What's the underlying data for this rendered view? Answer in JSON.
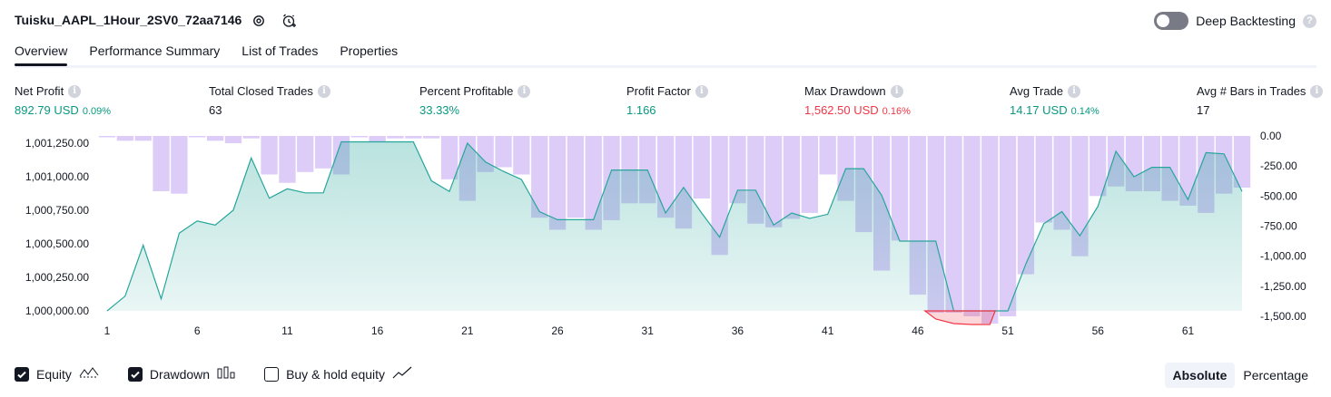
{
  "header": {
    "title": "Tuisku_AAPL_1Hour_2SV0_72aa7146",
    "settings_icon": "gear-icon",
    "alert_icon": "alarm-clock-plus-icon",
    "deep_backtesting_label": "Deep Backtesting",
    "deep_backtesting_enabled": false,
    "help_mark": "?"
  },
  "tabs": [
    {
      "label": "Overview",
      "active": true
    },
    {
      "label": "Performance Summary",
      "active": false
    },
    {
      "label": "List of Trades",
      "active": false
    },
    {
      "label": "Properties",
      "active": false
    }
  ],
  "stats": [
    {
      "label": "Net Profit",
      "value": "892.79 USD",
      "pct": "0.09%",
      "tone": "pos"
    },
    {
      "label": "Total Closed Trades",
      "value": "63",
      "pct": "",
      "tone": "neu"
    },
    {
      "label": "Percent Profitable",
      "value": "33.33%",
      "pct": "",
      "tone": "pos"
    },
    {
      "label": "Profit Factor",
      "value": "1.166",
      "pct": "",
      "tone": "pos"
    },
    {
      "label": "Max Drawdown",
      "value": "1,562.50 USD",
      "pct": "0.16%",
      "tone": "neg"
    },
    {
      "label": "Avg Trade",
      "value": "14.17 USD",
      "pct": "0.14%",
      "tone": "pos"
    },
    {
      "label": "Avg # Bars in Trades",
      "value": "17",
      "pct": "",
      "tone": "neu"
    }
  ],
  "info_mark": "i",
  "chart_data": {
    "type": "line",
    "x_ticks": [
      "1",
      "6",
      "11",
      "16",
      "21",
      "26",
      "31",
      "36",
      "41",
      "46",
      "51",
      "56",
      "61"
    ],
    "left_axis": {
      "ticks": [
        "1,001,250.00",
        "1,001,000.00",
        "1,000,750.00",
        "1,000,500.00",
        "1,000,250.00",
        "1,000,000.00"
      ],
      "ylim": [
        1000000,
        1001250
      ]
    },
    "right_axis": {
      "ticks": [
        "0.00",
        "-250.00",
        "-500.00",
        "-750.00",
        "-1,000.00",
        "-1,250.00",
        "-1,500.00"
      ],
      "ylim": [
        -1500,
        0
      ]
    },
    "series": [
      {
        "name": "Equity",
        "color": "#26a69a",
        "x": [
          1,
          2,
          3,
          4,
          5,
          6,
          7,
          8,
          9,
          10,
          11,
          12,
          13,
          14,
          15,
          16,
          17,
          18,
          19,
          20,
          21,
          22,
          23,
          24,
          25,
          26,
          27,
          28,
          29,
          30,
          31,
          32,
          33,
          34,
          35,
          36,
          37,
          38,
          39,
          40,
          41,
          42,
          43,
          44,
          45,
          46,
          47,
          48,
          49,
          50,
          51,
          52,
          53,
          54,
          55,
          56,
          57,
          58,
          59,
          60,
          61,
          62,
          63,
          64
        ],
        "values": [
          1000000,
          1000110,
          1000490,
          1000090,
          1000580,
          1000670,
          1000640,
          1000750,
          1001140,
          1000840,
          1000910,
          1000880,
          1000880,
          1001260,
          1001260,
          1001260,
          1001260,
          1001260,
          1000970,
          1000890,
          1001250,
          1001110,
          1001040,
          1000980,
          1000740,
          1000680,
          1000680,
          1000680,
          1001050,
          1001050,
          1001050,
          1000730,
          1000920,
          1000730,
          1000550,
          1000900,
          1000900,
          1000640,
          1000730,
          1000690,
          1000720,
          1001060,
          1001060,
          1000860,
          1000520,
          1000520,
          1000520,
          1000000,
          1000000,
          1000000,
          1000000,
          1000350,
          1000650,
          1000740,
          1000560,
          1000780,
          1001190,
          1001000,
          1001070,
          1001070,
          1000830,
          1001180,
          1001170,
          1000890
        ],
        "description": "approximate closed-trade equity curve"
      },
      {
        "name": "Drawdown",
        "color": "#b39ddb",
        "x": [
          1,
          2,
          3,
          4,
          5,
          6,
          7,
          8,
          9,
          10,
          11,
          12,
          13,
          14,
          15,
          16,
          17,
          18,
          19,
          20,
          21,
          22,
          23,
          24,
          25,
          26,
          27,
          28,
          29,
          30,
          31,
          32,
          33,
          34,
          35,
          36,
          37,
          38,
          39,
          40,
          41,
          42,
          43,
          44,
          45,
          46,
          47,
          48,
          49,
          50,
          51,
          52,
          53,
          54,
          55,
          56,
          57,
          58,
          59,
          60,
          61,
          62,
          63,
          64
        ],
        "values": [
          0,
          -40,
          -40,
          -460,
          -480,
          0,
          -40,
          -60,
          -20,
          -320,
          -390,
          -300,
          -270,
          -320,
          0,
          -50,
          -20,
          -20,
          -20,
          -360,
          -540,
          -300,
          -260,
          -320,
          -680,
          -780,
          -680,
          -780,
          -700,
          -560,
          -560,
          -680,
          -770,
          -520,
          -990,
          -560,
          -730,
          -760,
          -690,
          -640,
          -320,
          -540,
          -800,
          -1120,
          -870,
          -1320,
          -1470,
          -1470,
          -1500,
          -1560,
          -1500,
          -1150,
          -720,
          -780,
          -1000,
          -500,
          -420,
          -460,
          -460,
          -540,
          -580,
          -640,
          -480,
          -430
        ],
        "description": "approximate drawdown per trade"
      }
    ],
    "legend": [
      {
        "label": "Equity",
        "checked": true,
        "icon": "equity-line-icon"
      },
      {
        "label": "Drawdown",
        "checked": true,
        "icon": "drawdown-bars-icon"
      },
      {
        "label": "Buy & hold equity",
        "checked": false,
        "icon": "buy-hold-line-icon"
      }
    ],
    "grid": false
  },
  "mode_toggle": {
    "options": [
      "Absolute",
      "Percentage"
    ],
    "selected": "Absolute"
  },
  "colors": {
    "accent_green": "#089981",
    "accent_red": "#f23645",
    "equity_line": "#26a69a",
    "drawdown_fill": "#d9c7f7",
    "text": "#131722"
  }
}
